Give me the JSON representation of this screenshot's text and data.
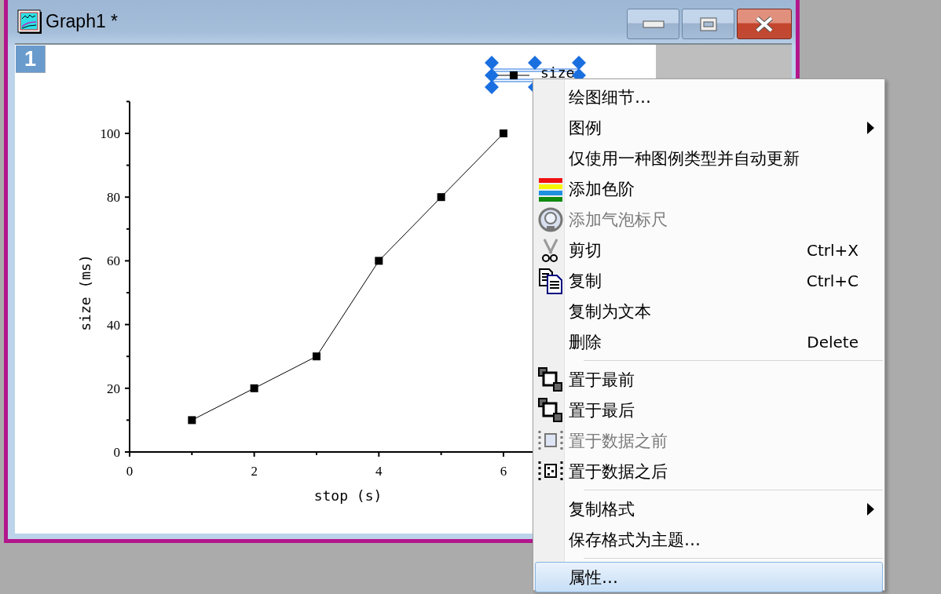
{
  "window": {
    "title": "Graph1 *",
    "page_number": "1"
  },
  "graph": {
    "chart_data": {
      "type": "line",
      "xlabel": "stop (s)",
      "ylabel": "size (ms)",
      "x": [
        1,
        2,
        3,
        4,
        5,
        6
      ],
      "series": [
        {
          "name": "size",
          "color": "#000000",
          "marker": "square",
          "values": [
            10,
            20,
            30,
            60,
            80,
            100
          ]
        }
      ],
      "xlim": [
        0,
        7
      ],
      "ylim": [
        0,
        110
      ],
      "xticks": [
        0,
        2,
        4,
        6
      ],
      "yticks": [
        0,
        20,
        40,
        60,
        80,
        100
      ]
    },
    "legend_selected": true
  },
  "context_menu": {
    "items": [
      {
        "kind": "item",
        "label": "绘图细节…",
        "submenu": false,
        "disabled": false,
        "selected": false
      },
      {
        "kind": "item",
        "label": "图例",
        "submenu": true,
        "disabled": false,
        "selected": false
      },
      {
        "kind": "item",
        "label": "仅使用一种图例类型并自动更新",
        "submenu": false,
        "disabled": false,
        "selected": false
      },
      {
        "kind": "item",
        "label": "添加色阶",
        "submenu": false,
        "disabled": false,
        "selected": false
      },
      {
        "kind": "item",
        "label": "添加气泡标尺",
        "submenu": false,
        "disabled": true,
        "selected": false
      },
      {
        "kind": "item",
        "label": "剪切",
        "shortcut": "Ctrl+X",
        "submenu": false,
        "disabled": false,
        "selected": false
      },
      {
        "kind": "item",
        "label": "复制",
        "shortcut": "Ctrl+C",
        "submenu": false,
        "disabled": false,
        "selected": false
      },
      {
        "kind": "item",
        "label": "复制为文本",
        "submenu": false,
        "disabled": false,
        "selected": false
      },
      {
        "kind": "item",
        "label": "删除",
        "shortcut": "Delete",
        "submenu": false,
        "disabled": false,
        "selected": false
      },
      {
        "kind": "separator"
      },
      {
        "kind": "item",
        "label": "置于最前",
        "submenu": false,
        "disabled": false,
        "selected": false
      },
      {
        "kind": "item",
        "label": "置于最后",
        "submenu": false,
        "disabled": false,
        "selected": false
      },
      {
        "kind": "item",
        "label": "置于数据之前",
        "submenu": false,
        "disabled": true,
        "selected": false
      },
      {
        "kind": "item",
        "label": "置于数据之后",
        "submenu": false,
        "disabled": false,
        "selected": false
      },
      {
        "kind": "separator"
      },
      {
        "kind": "item",
        "label": "复制格式",
        "submenu": true,
        "disabled": false,
        "selected": false
      },
      {
        "kind": "item",
        "label": "保存格式为主题…",
        "submenu": false,
        "disabled": false,
        "selected": false
      },
      {
        "kind": "separator"
      },
      {
        "kind": "item",
        "label": "属性…",
        "submenu": false,
        "disabled": false,
        "selected": true
      }
    ]
  }
}
